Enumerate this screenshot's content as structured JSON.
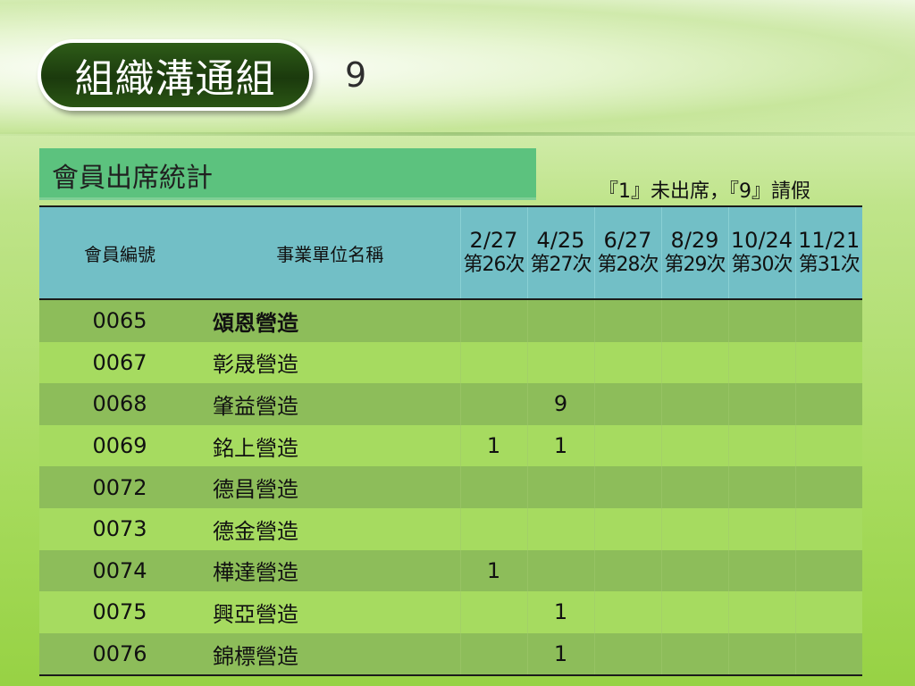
{
  "slide": {
    "title": "組織溝通組",
    "page_number": "9",
    "section_label": "會員出席統計",
    "legend": "『1』未出席，『9』請假"
  },
  "table": {
    "header": {
      "member_id": "會員編號",
      "company": "事業單位名稱",
      "sessions": [
        {
          "date": "2/27",
          "session": "第26次"
        },
        {
          "date": "4/25",
          "session": "第27次"
        },
        {
          "date": "6/27",
          "session": "第28次"
        },
        {
          "date": "8/29",
          "session": "第29次"
        },
        {
          "date": "10/24",
          "session": "第30次"
        },
        {
          "date": "11/21",
          "session": "第31次"
        }
      ]
    },
    "rows": [
      {
        "id": "0065",
        "name": "頌恩營造",
        "marks": [
          "",
          "",
          "",
          "",
          "",
          ""
        ]
      },
      {
        "id": "0067",
        "name": "彰晟營造",
        "marks": [
          "",
          "",
          "",
          "",
          "",
          ""
        ]
      },
      {
        "id": "0068",
        "name": "肇益營造",
        "marks": [
          "",
          "9",
          "",
          "",
          "",
          ""
        ]
      },
      {
        "id": "0069",
        "name": "銘上營造",
        "marks": [
          "1",
          "1",
          "",
          "",
          "",
          ""
        ]
      },
      {
        "id": "0072",
        "name": "德昌營造",
        "marks": [
          "",
          "",
          "",
          "",
          "",
          ""
        ]
      },
      {
        "id": "0073",
        "name": "德金營造",
        "marks": [
          "",
          "",
          "",
          "",
          "",
          ""
        ]
      },
      {
        "id": "0074",
        "name": "樺達營造",
        "marks": [
          "1",
          "",
          "",
          "",
          "",
          ""
        ]
      },
      {
        "id": "0075",
        "name": "興亞營造",
        "marks": [
          "",
          "1",
          "",
          "",
          "",
          ""
        ]
      },
      {
        "id": "0076",
        "name": "錦標營造",
        "marks": [
          "",
          "1",
          "",
          "",
          "",
          ""
        ]
      }
    ]
  },
  "colors": {
    "title_badge": "#1f4410",
    "header_bg": "#72bfc6",
    "section_label_bg": "#5cc27e",
    "row_odd": "#8dbd5a",
    "row_even": "#a6db60"
  }
}
